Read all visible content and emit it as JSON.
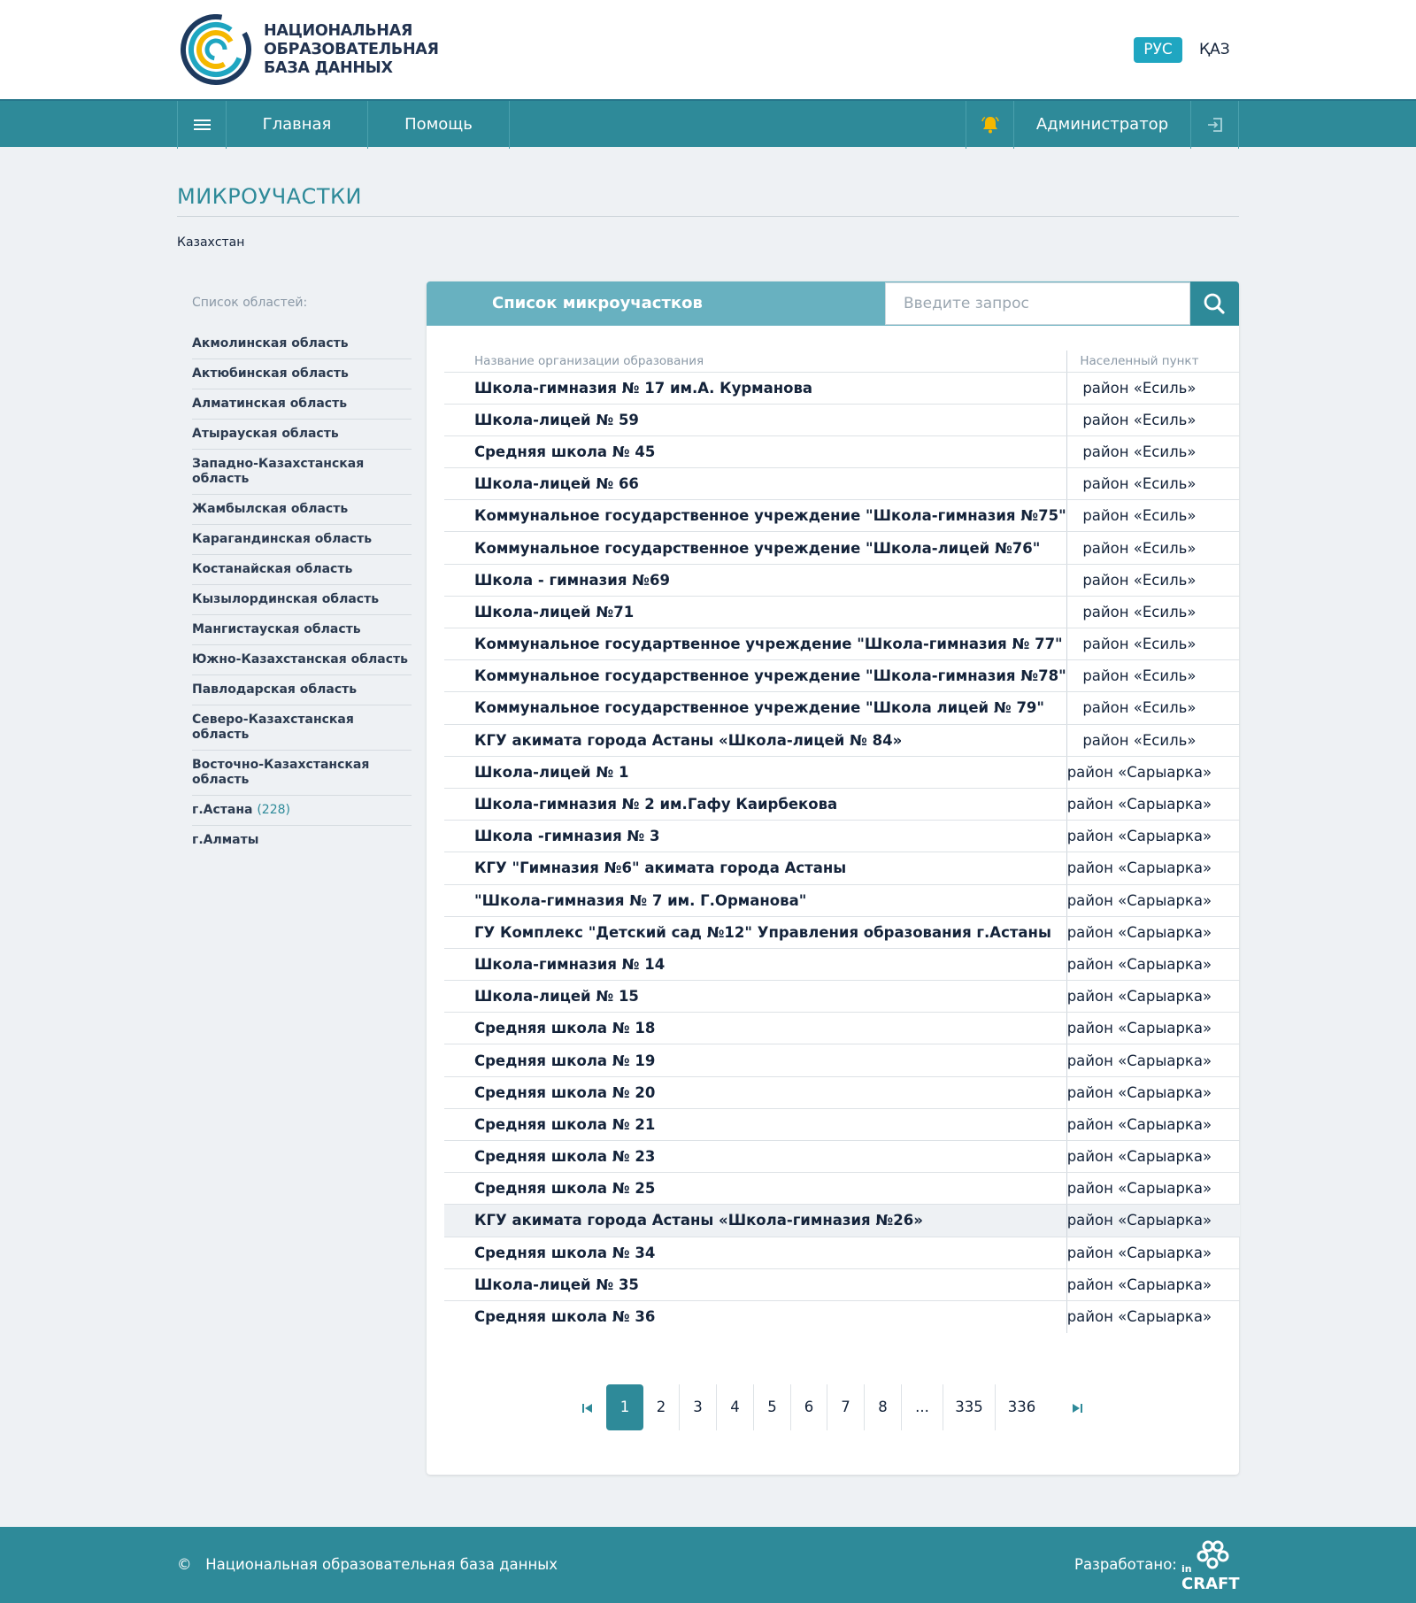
{
  "header": {
    "logo_line1": "НАЦИОНАЛЬНАЯ",
    "logo_line2": "ОБРАЗОВАТЕЛЬНАЯ",
    "logo_line3": "БАЗА ДАННЫХ",
    "lang_ru": "РУС",
    "lang_kz": "ҚАЗ"
  },
  "nav": {
    "home": "Главная",
    "help": "Помощь",
    "user": "Администратор"
  },
  "page": {
    "title": "МИКРОУЧАСТКИ",
    "breadcrumb": "Казахстан"
  },
  "sidebar": {
    "title": "Список областей:",
    "items": [
      {
        "label": "Акмолинская область",
        "count": ""
      },
      {
        "label": "Актюбинская область",
        "count": ""
      },
      {
        "label": "Алматинская область",
        "count": ""
      },
      {
        "label": "Атырауская область",
        "count": ""
      },
      {
        "label": "Западно-Казахстанская область",
        "count": ""
      },
      {
        "label": "Жамбылская область",
        "count": ""
      },
      {
        "label": "Карагандинская область",
        "count": ""
      },
      {
        "label": "Костанайская область",
        "count": ""
      },
      {
        "label": "Кызылординская область",
        "count": ""
      },
      {
        "label": "Мангистауская область",
        "count": ""
      },
      {
        "label": "Южно-Казахстанская область",
        "count": ""
      },
      {
        "label": "Павлодарская область",
        "count": ""
      },
      {
        "label": "Северо-Казахстанская область",
        "count": ""
      },
      {
        "label": "Восточно-Казахстанская область",
        "count": ""
      },
      {
        "label": "г.Астана",
        "count": "(228)"
      },
      {
        "label": "г.Алматы",
        "count": ""
      }
    ]
  },
  "panel": {
    "title": "Список микроучастков",
    "search_placeholder": "Введите запрос",
    "columns": [
      "Название организации образования",
      "Населенный пункт"
    ],
    "rows": [
      [
        "Школа-гимназия № 17 им.А. Курманова",
        "район «Есиль»"
      ],
      [
        "Школа-лицей № 59",
        "район «Есиль»"
      ],
      [
        "Средняя школа № 45",
        "район «Есиль»"
      ],
      [
        "Школа-лицей № 66",
        "район «Есиль»"
      ],
      [
        "Коммунальное государственное учреждение \"Школа-гимназия №75\"",
        "район «Есиль»"
      ],
      [
        "Коммунальное государственное учреждение \"Школа-лицей №76\"",
        "район «Есиль»"
      ],
      [
        "Школа - гимназия №69",
        "район «Есиль»"
      ],
      [
        "Школа-лицей №71",
        "район «Есиль»"
      ],
      [
        "Коммунальное государтвенное учреждение \"Школа-гимназия № 77\"",
        "район «Есиль»"
      ],
      [
        "Коммунальное государственное учреждение \"Школа-гимназия №78\"",
        "район «Есиль»"
      ],
      [
        "Коммунальное государственное учреждение \"Школа лицей № 79\"",
        "район «Есиль»"
      ],
      [
        "КГУ акимата города Астаны «Школа-лицей № 84»",
        "район «Есиль»"
      ],
      [
        "Школа-лицей № 1",
        "район «Сарыарка»"
      ],
      [
        "Школа-гимназия № 2 им.Гафу Каирбекова",
        "район «Сарыарка»"
      ],
      [
        "Школа -гимназия № 3",
        "район «Сарыарка»"
      ],
      [
        "КГУ \"Гимназия №6\" акимата города Астаны",
        "район «Сарыарка»"
      ],
      [
        "\"Школа-гимназия № 7 им. Г.Орманова\"",
        "район «Сарыарка»"
      ],
      [
        "ГУ Комплекс \"Детский сад №12\" Управления образования г.Астаны",
        "район «Сарыарка»"
      ],
      [
        "Школа-гимназия № 14",
        "район «Сарыарка»"
      ],
      [
        "Школа-лицей № 15",
        "район «Сарыарка»"
      ],
      [
        "Средняя школа № 18",
        "район «Сарыарка»"
      ],
      [
        "Средняя школа № 19",
        "район «Сарыарка»"
      ],
      [
        "Средняя школа № 20",
        "район «Сарыарка»"
      ],
      [
        "Средняя школа № 21",
        "район «Сарыарка»"
      ],
      [
        "Средняя школа № 23",
        "район «Сарыарка»"
      ],
      [
        "Средняя школа № 25",
        "район «Сарыарка»"
      ],
      [
        "КГУ акимата города Астаны «Школа-гимназия №26»",
        "район «Сарыарка»"
      ],
      [
        "Средняя школа № 34",
        "район «Сарыарка»"
      ],
      [
        "Школа-лицей № 35",
        "район «Сарыарка»"
      ],
      [
        "Средняя школа № 36",
        "район «Сарыарка»"
      ]
    ],
    "highlighted_row": 26
  },
  "pagination": {
    "pages": [
      "1",
      "2",
      "3",
      "4",
      "5",
      "6",
      "7",
      "8",
      "...",
      "335",
      "336"
    ],
    "active": "1"
  },
  "footer": {
    "copyright_symbol": "©",
    "copyright": "Национальная образовательная база данных",
    "developed_by": "Разработано:",
    "dev_logo_text_in": "in",
    "dev_logo_text_craft": "CRAFT"
  },
  "colors": {
    "primary": "#2e8a99",
    "panel_header": "#68b1c0",
    "lang_active": "#1fa6c1",
    "bell": "#f5b800"
  },
  "icons": [
    "menu-icon",
    "bell-icon",
    "logout-icon",
    "search-icon",
    "first-page-icon",
    "last-page-icon"
  ]
}
